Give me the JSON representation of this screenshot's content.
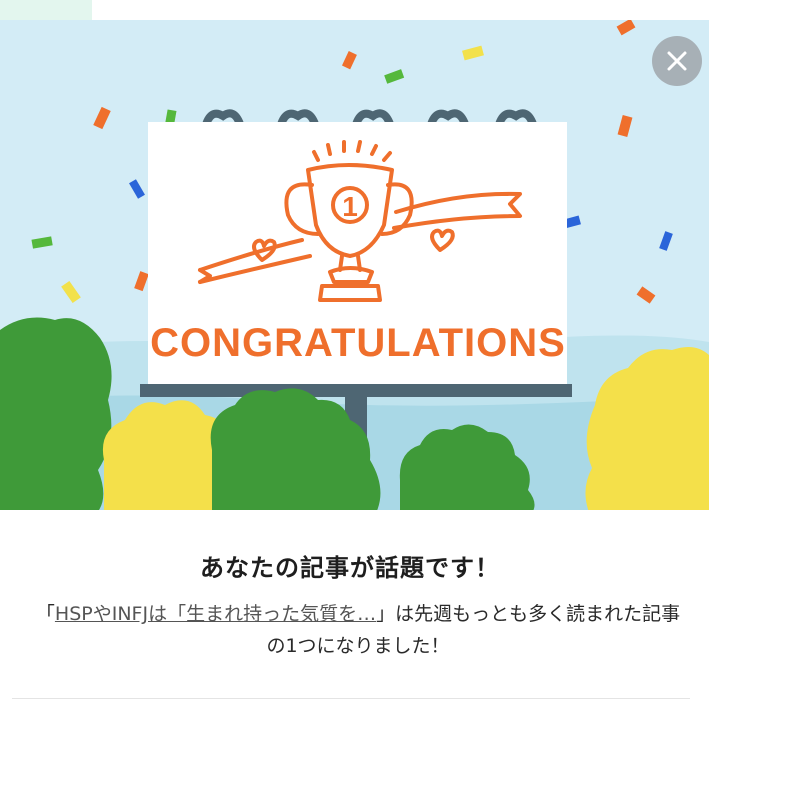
{
  "modal": {
    "close_icon": "close-icon",
    "illustration": {
      "billboard_text": "CONGRATULATIONS",
      "trophy_number": "1",
      "colors": {
        "sky": "#d3ecf6",
        "accent_orange": "#ef6f2c",
        "tree_green": "#3f9a39",
        "tree_yellow": "#f4e04a",
        "pole": "#4e6673"
      }
    },
    "title": "あなたの記事が話題です！",
    "message": {
      "open_quote": "「",
      "article_link": "HSPやINFJは「生まれ持った気質を…",
      "suffix": "」は先週もっとも多く読まれた記事の1つになりました！"
    }
  }
}
